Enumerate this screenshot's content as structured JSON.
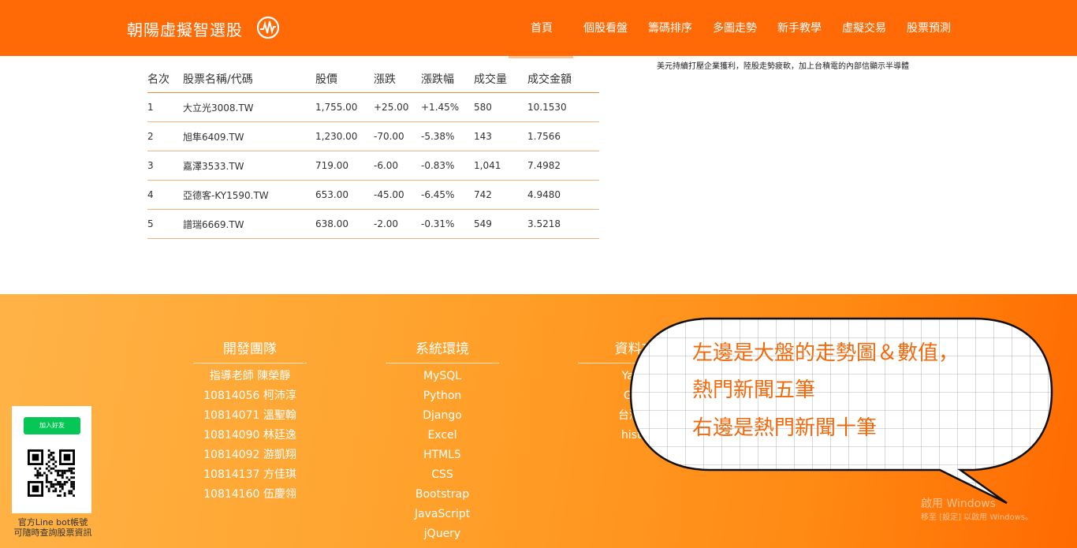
{
  "brand": {
    "title": "朝陽虛擬智選股"
  },
  "nav": [
    {
      "label": "首頁"
    },
    {
      "label": "個股看盤"
    },
    {
      "label": "籌碼排序"
    },
    {
      "label": "多圖走勢"
    },
    {
      "label": "新手教學"
    },
    {
      "label": "虛擬交易"
    },
    {
      "label": "股票預測"
    }
  ],
  "ticker_text": "美元持續打壓企業獲利，陸股走勢疲軟，加上台積電的內部信顯示半導體",
  "table": {
    "headers": [
      "名次",
      "股票名稱/代碼",
      "股價",
      "漲跌",
      "漲跌幅",
      "成交量",
      "成交金額"
    ],
    "rows": [
      {
        "rank": "1",
        "name": "大立光3008.TW",
        "price": "1,755.00",
        "change": "+25.00",
        "pct": "+1.45%",
        "volume": "580",
        "amount": "10.1530",
        "dir": "up"
      },
      {
        "rank": "2",
        "name": "旭隼6409.TW",
        "price": "1,230.00",
        "change": "-70.00",
        "pct": "-5.38%",
        "volume": "143",
        "amount": "1.7566",
        "dir": "down"
      },
      {
        "rank": "3",
        "name": "嘉澤3533.TW",
        "price": "719.00",
        "change": "-6.00",
        "pct": "-0.83%",
        "volume": "1,041",
        "amount": "7.4982",
        "dir": "down"
      },
      {
        "rank": "4",
        "name": "亞德客-KY1590.TW",
        "price": "653.00",
        "change": "-45.00",
        "pct": "-6.45%",
        "volume": "742",
        "amount": "4.9480",
        "dir": "down"
      },
      {
        "rank": "5",
        "name": "譜瑞6669.TW",
        "price": "638.00",
        "change": "-2.00",
        "pct": "-0.31%",
        "volume": "549",
        "amount": "3.5218",
        "dir": "down"
      }
    ]
  },
  "footer": {
    "team": {
      "title": "開發團隊",
      "items": [
        "指導老師 陳榮靜",
        "10814056 柯沛淳",
        "10814071 溫聖翰",
        "10814090 林廷逸",
        "10814092 游凱翔",
        "10814137 方佳琪",
        "10814160 伍慶翎"
      ]
    },
    "env": {
      "title": "系統環境",
      "items": [
        "MySQL",
        "Python",
        "Django",
        "Excel",
        "HTML5",
        "CSS",
        "Bootstrap",
        "JavaScript",
        "jQuery"
      ]
    },
    "source": {
      "title": "資料來",
      "items": [
        "Yaho",
        "Goo",
        "台灣證",
        "histo"
      ]
    }
  },
  "line": {
    "button_label": "加入好友",
    "caption_line1": "官方Line bot帳號",
    "caption_line2": "可隨時查詢股票資訊"
  },
  "bubble": {
    "line1": "左邊是大盤的走勢圖＆數值，",
    "line2": "熱門新聞五筆",
    "line3": "右邊是熱門新聞十筆"
  },
  "watermark": {
    "line1": "啟用 Windows",
    "line2": "移至 [設定] 以啟用 Windows。"
  },
  "colors": {
    "accent": "#ff6a07",
    "up": "#e8201b",
    "down": "#2e8b2e",
    "bubble_text": "#f06a0c"
  }
}
